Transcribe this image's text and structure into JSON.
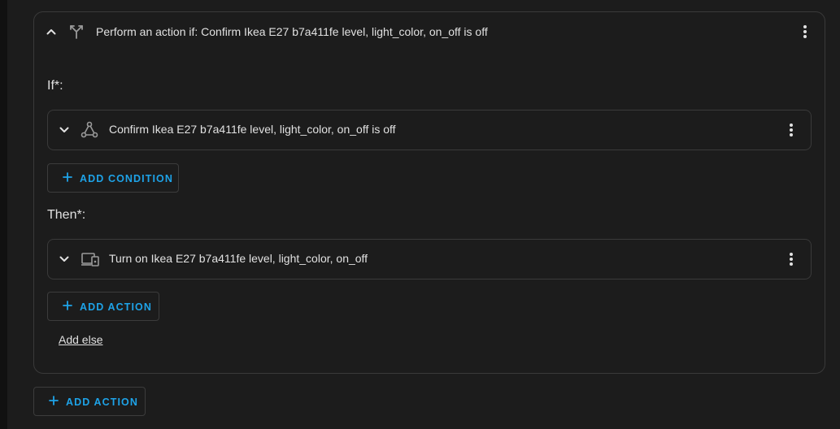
{
  "choose_block": {
    "header": {
      "title": "Perform an action if: Confirm Ikea E27 b7a411fe level, light_color, on_off is off",
      "collapse_icon": "chevron-up-icon",
      "type_icon": "call-split-icon",
      "menu_icon": "dots-vertical-icon"
    },
    "if_label": "If*:",
    "condition": {
      "title": "Confirm Ikea E27 b7a411fe level, light_color, on_off is off",
      "expand_icon": "chevron-down-icon",
      "type_icon": "state-graph-icon",
      "menu_icon": "dots-vertical-icon"
    },
    "add_condition_label": "ADD CONDITION",
    "then_label": "Then*:",
    "action": {
      "title": "Turn on Ikea E27 b7a411fe level, light_color, on_off",
      "expand_icon": "chevron-down-icon",
      "type_icon": "devices-icon",
      "menu_icon": "dots-vertical-icon"
    },
    "add_action_label": "ADD ACTION",
    "add_else_label": "Add else"
  },
  "add_action_label": "ADD ACTION",
  "colors": {
    "background": "#111111",
    "panel": "#1c1c1c",
    "border": "#3a3a3a",
    "text": "#e1e1e1",
    "accent": "#1ea3e8"
  }
}
